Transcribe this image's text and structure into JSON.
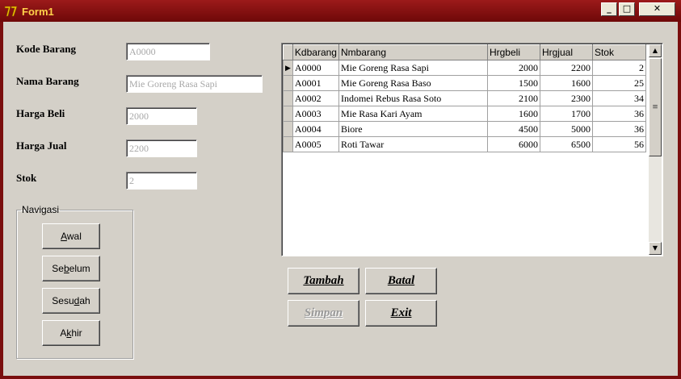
{
  "window": {
    "title": "Form1"
  },
  "titlebar": {
    "minimize": "_",
    "maximize": "□",
    "close": "✕"
  },
  "form": {
    "fields": [
      {
        "label": "Kode Barang",
        "value": "A0000"
      },
      {
        "label": "Nama Barang",
        "value": "Mie Goreng Rasa Sapi"
      },
      {
        "label": "Harga Beli",
        "value": "2000"
      },
      {
        "label": "Harga Jual",
        "value": "2200"
      },
      {
        "label": "Stok",
        "value": "2"
      }
    ]
  },
  "navigation": {
    "legend": "Navigasi",
    "buttons": [
      {
        "pre": "",
        "key": "A",
        "post": "wal"
      },
      {
        "pre": "Se",
        "key": "b",
        "post": "elum"
      },
      {
        "pre": "Sesu",
        "key": "d",
        "post": "ah"
      },
      {
        "pre": "A",
        "key": "k",
        "post": "hir"
      }
    ]
  },
  "grid": {
    "columns": [
      "Kdbarang",
      "Nmbarang",
      "Hrgbeli",
      "Hrgjual",
      "Stok"
    ],
    "current_row_indicator": "▶",
    "rows": [
      {
        "kode": "A0000",
        "nama": "Mie Goreng Rasa Sapi",
        "beli": "2000",
        "jual": "2200",
        "stok": "2"
      },
      {
        "kode": "A0001",
        "nama": "Mie Goreng Rasa Baso",
        "beli": "1500",
        "jual": "1600",
        "stok": "25"
      },
      {
        "kode": "A0002",
        "nama": "Indomei Rebus Rasa Soto",
        "beli": "2100",
        "jual": "2300",
        "stok": "34"
      },
      {
        "kode": "A0003",
        "nama": "Mie Rasa Kari Ayam",
        "beli": "1600",
        "jual": "1700",
        "stok": "36"
      },
      {
        "kode": "A0004",
        "nama": "Biore",
        "beli": "4500",
        "jual": "5000",
        "stok": "36"
      },
      {
        "kode": "A0005",
        "nama": "Roti Tawar",
        "beli": "6000",
        "jual": "6500",
        "stok": "56"
      }
    ]
  },
  "actions": {
    "tambah": "Tambah",
    "batal": "Batal",
    "simpan": "Simpan",
    "exit": "Exit"
  },
  "icons": {
    "app": "delphi-app-icon",
    "scroll_up": "▲",
    "scroll_down": "▼",
    "grip": "≡"
  }
}
